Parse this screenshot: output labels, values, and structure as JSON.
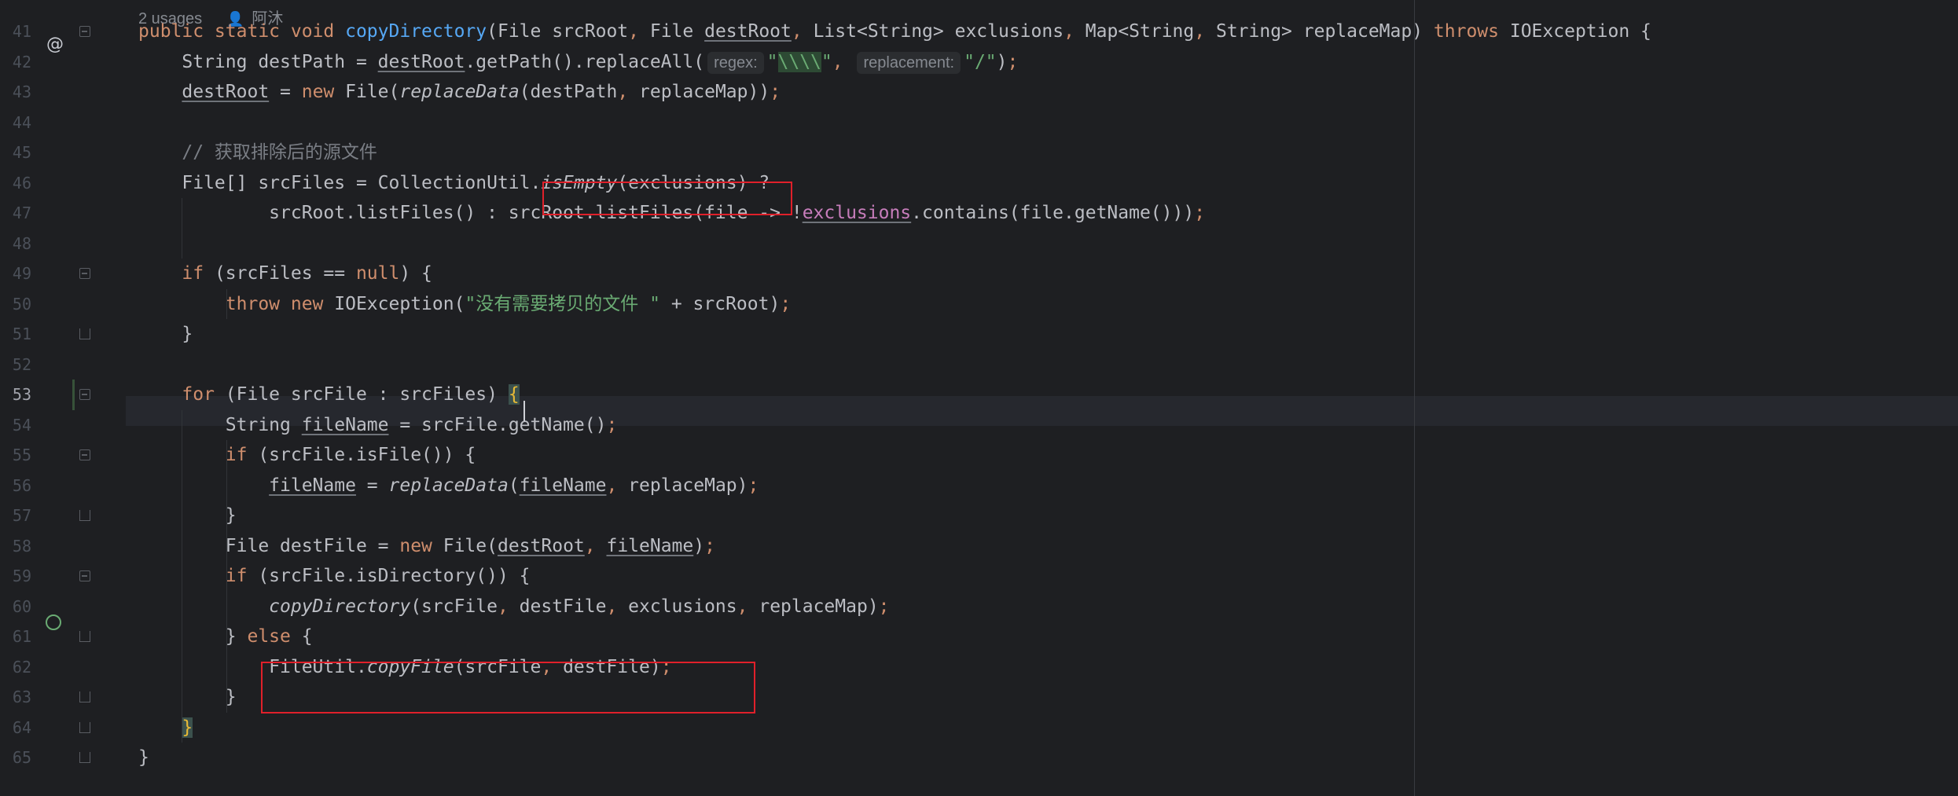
{
  "editor": {
    "usages_label": "2 usages",
    "author_label": "阿沐",
    "current_line": 53
  },
  "lines": [
    {
      "n": "41",
      "segments": [
        {
          "t": "public static void ",
          "c": "kw"
        },
        {
          "t": "copyDirectory",
          "c": "fn"
        },
        {
          "t": "(File srcRoot",
          "c": ""
        },
        {
          "t": ", ",
          "c": "sep"
        },
        {
          "t": "File ",
          "c": ""
        },
        {
          "t": "destRoot",
          "c": "ul"
        },
        {
          "t": ", ",
          "c": "sep"
        },
        {
          "t": "List<String> exclusions",
          "c": ""
        },
        {
          "t": ", ",
          "c": "sep"
        },
        {
          "t": "Map<String",
          "c": ""
        },
        {
          "t": ", ",
          "c": "sep"
        },
        {
          "t": "String> replaceMap) ",
          "c": ""
        },
        {
          "t": "throws ",
          "c": "kw"
        },
        {
          "t": "IOException {",
          "c": ""
        }
      ]
    },
    {
      "n": "42",
      "segments": [
        {
          "t": "    String destPath = ",
          "c": ""
        },
        {
          "t": "destRoot",
          "c": "ul"
        },
        {
          "t": ".getPath().replaceAll(",
          "c": ""
        },
        {
          "hint": "regex:"
        },
        {
          "t": "\"",
          "c": "str"
        },
        {
          "t": "\\\\\\\\",
          "c": "str strhl"
        },
        {
          "t": "\"",
          "c": "str"
        },
        {
          "t": ", ",
          "c": "sep"
        },
        {
          "hint": "replacement:"
        },
        {
          "t": "\"/\"",
          "c": "str"
        },
        {
          "t": ")",
          "c": ""
        },
        {
          "t": ";",
          "c": "sep"
        }
      ]
    },
    {
      "n": "43",
      "segments": [
        {
          "t": "    ",
          "c": ""
        },
        {
          "t": "destRoot",
          "c": "ul"
        },
        {
          "t": " = ",
          "c": ""
        },
        {
          "t": "new ",
          "c": "kw"
        },
        {
          "t": "File(",
          "c": ""
        },
        {
          "t": "replaceData",
          "c": "ital"
        },
        {
          "t": "(destPath",
          "c": ""
        },
        {
          "t": ", ",
          "c": "sep"
        },
        {
          "t": "replaceMap))",
          "c": ""
        },
        {
          "t": ";",
          "c": "sep"
        }
      ]
    },
    {
      "n": "44",
      "segments": []
    },
    {
      "n": "45",
      "segments": [
        {
          "t": "    // 获取排除后的源文件",
          "c": "cmt"
        }
      ]
    },
    {
      "n": "46",
      "segments": [
        {
          "t": "    File[] srcFiles = CollectionUtil.",
          "c": ""
        },
        {
          "t": "isEmpty",
          "c": "ital"
        },
        {
          "t": "(exclusions) ?",
          "c": ""
        }
      ]
    },
    {
      "n": "47",
      "segments": [
        {
          "t": "            srcRoot.listFiles() : srcRoot.listFiles(file -> !",
          "c": ""
        },
        {
          "t": "exclusions",
          "c": "field ul"
        },
        {
          "t": ".contains(file.getName()))",
          "c": ""
        },
        {
          "t": ";",
          "c": "sep"
        }
      ]
    },
    {
      "n": "48",
      "segments": []
    },
    {
      "n": "49",
      "segments": [
        {
          "t": "    ",
          "c": ""
        },
        {
          "t": "if ",
          "c": "kw"
        },
        {
          "t": "(srcFiles == ",
          "c": ""
        },
        {
          "t": "null",
          "c": "kw"
        },
        {
          "t": ") {",
          "c": ""
        }
      ]
    },
    {
      "n": "50",
      "segments": [
        {
          "t": "        ",
          "c": ""
        },
        {
          "t": "throw new ",
          "c": "kw"
        },
        {
          "t": "IOException(",
          "c": ""
        },
        {
          "t": "\"没有需要拷贝的文件 \"",
          "c": "str"
        },
        {
          "t": " + srcRoot)",
          "c": ""
        },
        {
          "t": ";",
          "c": "sep"
        }
      ]
    },
    {
      "n": "51",
      "segments": [
        {
          "t": "    }",
          "c": ""
        }
      ]
    },
    {
      "n": "52",
      "segments": []
    },
    {
      "n": "53",
      "segments": [
        {
          "t": "    ",
          "c": ""
        },
        {
          "t": "for ",
          "c": "kw"
        },
        {
          "t": "(File srcFile : srcFiles) ",
          "c": ""
        },
        {
          "t": "{",
          "c": "brace-hl-y"
        }
      ]
    },
    {
      "n": "54",
      "segments": [
        {
          "t": "        String ",
          "c": ""
        },
        {
          "t": "fileName",
          "c": "ul"
        },
        {
          "t": " = srcFile.getName()",
          "c": ""
        },
        {
          "t": ";",
          "c": "sep"
        }
      ]
    },
    {
      "n": "55",
      "segments": [
        {
          "t": "        ",
          "c": ""
        },
        {
          "t": "if ",
          "c": "kw"
        },
        {
          "t": "(srcFile.isFile()) {",
          "c": ""
        }
      ]
    },
    {
      "n": "56",
      "segments": [
        {
          "t": "            ",
          "c": ""
        },
        {
          "t": "fileName",
          "c": "ul"
        },
        {
          "t": " = ",
          "c": ""
        },
        {
          "t": "replaceData",
          "c": "ital"
        },
        {
          "t": "(",
          "c": ""
        },
        {
          "t": "fileName",
          "c": "ul"
        },
        {
          "t": ", ",
          "c": "sep"
        },
        {
          "t": "replaceMap)",
          "c": ""
        },
        {
          "t": ";",
          "c": "sep"
        }
      ]
    },
    {
      "n": "57",
      "segments": [
        {
          "t": "        }",
          "c": ""
        }
      ]
    },
    {
      "n": "58",
      "segments": [
        {
          "t": "        File destFile = ",
          "c": ""
        },
        {
          "t": "new ",
          "c": "kw"
        },
        {
          "t": "File(",
          "c": ""
        },
        {
          "t": "destRoot",
          "c": "ul"
        },
        {
          "t": ", ",
          "c": "sep"
        },
        {
          "t": "fileName",
          "c": "ul"
        },
        {
          "t": ")",
          "c": ""
        },
        {
          "t": ";",
          "c": "sep"
        }
      ]
    },
    {
      "n": "59",
      "segments": [
        {
          "t": "        ",
          "c": ""
        },
        {
          "t": "if ",
          "c": "kw"
        },
        {
          "t": "(srcFile.isDirectory()) {",
          "c": ""
        }
      ]
    },
    {
      "n": "60",
      "segments": [
        {
          "t": "            ",
          "c": ""
        },
        {
          "t": "copyDirectory",
          "c": "ital"
        },
        {
          "t": "(srcFile",
          "c": ""
        },
        {
          "t": ", ",
          "c": "sep"
        },
        {
          "t": "destFile",
          "c": ""
        },
        {
          "t": ", ",
          "c": "sep"
        },
        {
          "t": "exclusions",
          "c": ""
        },
        {
          "t": ", ",
          "c": "sep"
        },
        {
          "t": "replaceMap)",
          "c": ""
        },
        {
          "t": ";",
          "c": "sep"
        }
      ]
    },
    {
      "n": "61",
      "segments": [
        {
          "t": "        } ",
          "c": ""
        },
        {
          "t": "else ",
          "c": "kw"
        },
        {
          "t": "{",
          "c": ""
        }
      ]
    },
    {
      "n": "62",
      "segments": [
        {
          "t": "            FileUtil.",
          "c": ""
        },
        {
          "t": "copyFile",
          "c": "ital"
        },
        {
          "t": "(srcFile",
          "c": ""
        },
        {
          "t": ", ",
          "c": "sep"
        },
        {
          "t": "destFile)",
          "c": ""
        },
        {
          "t": ";",
          "c": "sep"
        }
      ]
    },
    {
      "n": "63",
      "segments": [
        {
          "t": "        }",
          "c": ""
        }
      ]
    },
    {
      "n": "64",
      "segments": [
        {
          "t": "    ",
          "c": ""
        },
        {
          "t": "}",
          "c": "brace-hl-y"
        }
      ]
    },
    {
      "n": "65",
      "segments": [
        {
          "t": "}",
          "c": ""
        }
      ]
    }
  ],
  "colors": {
    "background": "#1e1f22",
    "keyword": "#cf8e6d",
    "function": "#56a8f5",
    "string": "#6aab73",
    "comment": "#7a7e85",
    "annotation_box": "#e0202a"
  },
  "icons": {
    "line41": "override-at-icon",
    "line60": "recursive-call-icon"
  }
}
